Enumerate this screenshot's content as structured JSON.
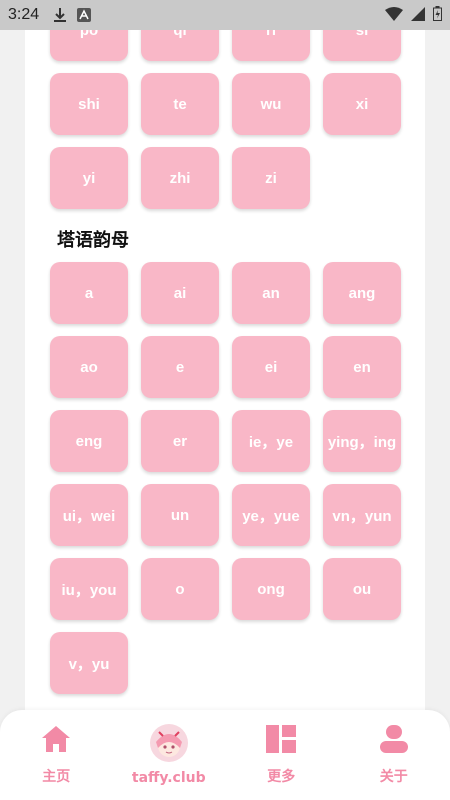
{
  "status_bar": {
    "time": "3:24"
  },
  "grid_top": [
    "po",
    "qi",
    "ri",
    "si",
    "shi",
    "te",
    "wu",
    "xi",
    "yi",
    "zhi",
    "zi"
  ],
  "section": {
    "title": "塔语韵母"
  },
  "grid_finals": [
    "a",
    "ai",
    "an",
    "ang",
    "ao",
    "e",
    "ei",
    "en",
    "eng",
    "er",
    "ie，ye",
    "ying，ing",
    "ui，wei",
    "un",
    "ye，yue",
    "vn，yun",
    "iu，you",
    "o",
    "ong",
    "ou",
    "v，yu"
  ],
  "bottom_nav": [
    {
      "label": "主页",
      "icon": "home-icon"
    },
    {
      "label": "taffy.club",
      "icon": "avatar-icon"
    },
    {
      "label": "更多",
      "icon": "grid-icon"
    },
    {
      "label": "关于",
      "icon": "user-icon"
    }
  ],
  "colors": {
    "tile": "#f9b7c7",
    "accent": "#f28aa6"
  }
}
